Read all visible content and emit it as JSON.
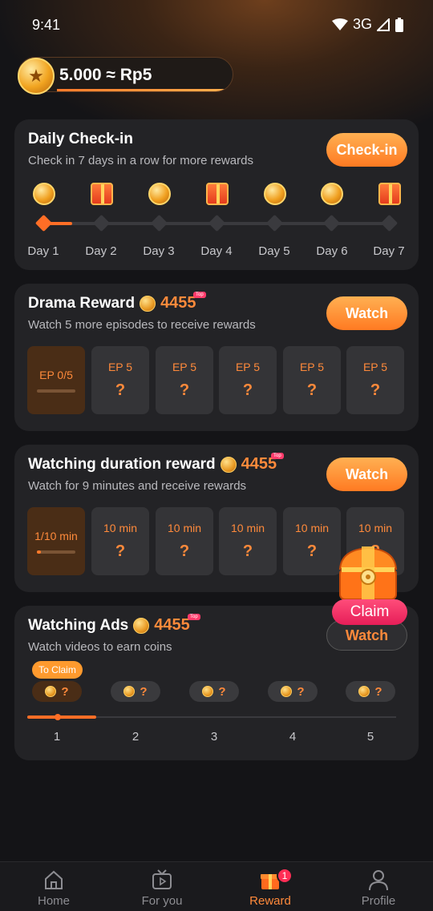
{
  "status_bar": {
    "time": "9:41",
    "network": "3G"
  },
  "wallet": {
    "balance": "5.000 ≈ Rp5"
  },
  "checkin": {
    "title": "Daily Check-in",
    "subtitle": "Check in 7 days in a row for more rewards",
    "button": "Check-in",
    "days": [
      {
        "label": "Day 1",
        "icon": "coin-icon"
      },
      {
        "label": "Day 2",
        "icon": "gift-icon"
      },
      {
        "label": "Day 3",
        "icon": "coin-icon"
      },
      {
        "label": "Day 4",
        "icon": "gift-icon"
      },
      {
        "label": "Day 5",
        "icon": "coin-icon"
      },
      {
        "label": "Day 6",
        "icon": "coin-icon"
      },
      {
        "label": "Day 7",
        "icon": "mystery-gift-icon"
      }
    ],
    "progress_days_done": 1
  },
  "drama": {
    "title": "Drama Reward",
    "amount": "4455",
    "badge": "Top",
    "subtitle": "Watch 5 more episodes to receive rewards",
    "button": "Watch",
    "tiles": [
      "EP 0/5",
      "EP 5",
      "EP 5",
      "EP 5",
      "EP 5",
      "EP 5"
    ],
    "mystery": "?"
  },
  "duration": {
    "title": "Watching duration reward",
    "amount": "4455",
    "badge": "Top",
    "subtitle": "Watch for 9 minutes and receive rewards",
    "button": "Watch",
    "tiles": [
      "1/10 min",
      "10 min",
      "10 min",
      "10 min",
      "10 min",
      "10 min"
    ],
    "mystery": "?",
    "progress_fraction": 0.1
  },
  "floating": {
    "claim": "Claim"
  },
  "ads": {
    "title": "Watching Ads",
    "amount": "4455",
    "badge": "Top",
    "subtitle": "Watch videos to earn coins",
    "button": "Watch",
    "to_claim": "To Claim",
    "slots": [
      "1",
      "2",
      "3",
      "4",
      "5"
    ],
    "mystery": "?"
  },
  "nav": {
    "items": [
      {
        "label": "Home",
        "icon": "home-icon"
      },
      {
        "label": "For you",
        "icon": "tv-icon"
      },
      {
        "label": "Reward",
        "icon": "gift-icon",
        "badge": "1"
      },
      {
        "label": "Profile",
        "icon": "person-icon"
      }
    ]
  },
  "colors": {
    "accent": "#ff7a22",
    "claim": "#ff2d55",
    "background": "#141417"
  }
}
